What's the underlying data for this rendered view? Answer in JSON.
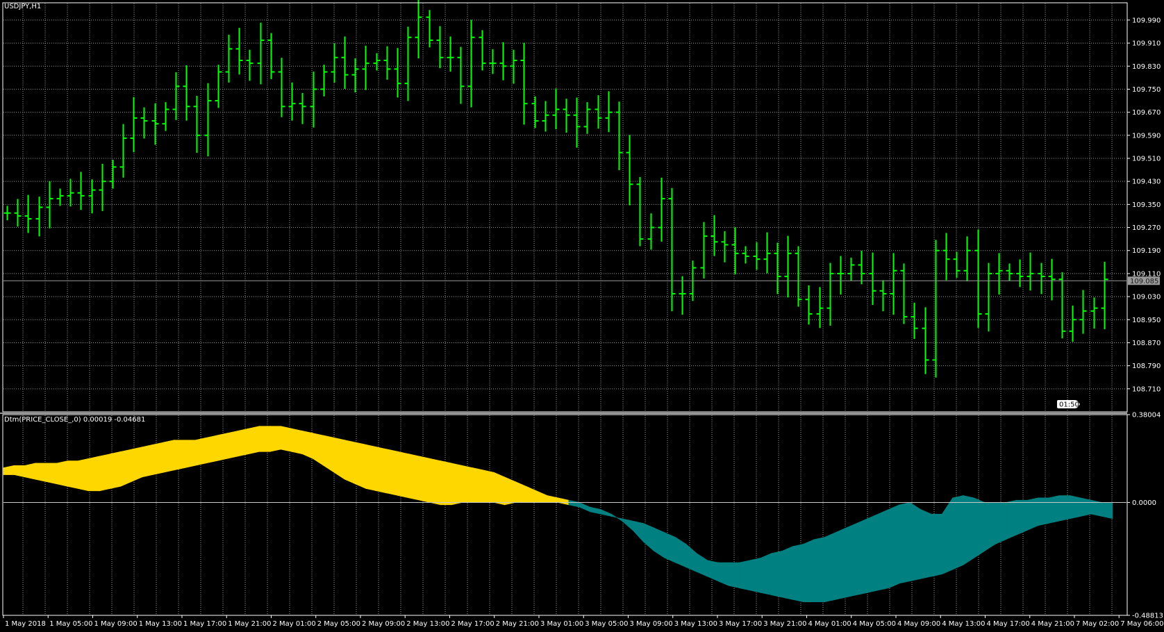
{
  "window": {
    "title": "USDJPY,H1",
    "indicator_title": "Dtm(PRICE_CLOSE_,0) 0.00019 -0.04681"
  },
  "colors": {
    "background": "#000000",
    "grid": "#9a9a9a",
    "bars": "#00ff00",
    "fill_positive": "#ffd700",
    "fill_negative": "#008080",
    "axis_text": "#ffffff"
  },
  "chart_data": [
    {
      "type": "ohlc",
      "symbol": "USDJPY",
      "timeframe": "H1",
      "title": "USDJPY,H1",
      "ylim": [
        108.63,
        110.05
      ],
      "y_ticks": [
        "109.990",
        "109.910",
        "109.830",
        "109.750",
        "109.670",
        "109.590",
        "109.510",
        "109.430",
        "109.350",
        "109.270",
        "109.190",
        "109.110",
        "109.030",
        "108.950",
        "108.870",
        "108.790",
        "108.710"
      ],
      "x_labels": [
        "1 May 2018",
        "1 May 05:00",
        "1 May 09:00",
        "1 May 13:00",
        "1 May 17:00",
        "1 May 21:00",
        "2 May 01:00",
        "2 May 05:00",
        "2 May 09:00",
        "2 May 13:00",
        "2 May 17:00",
        "2 May 21:00",
        "3 May 01:00",
        "3 May 05:00",
        "3 May 09:00",
        "3 May 13:00",
        "3 May 17:00",
        "3 May 21:00",
        "4 May 01:00",
        "4 May 05:00",
        "4 May 09:00",
        "4 May 13:00",
        "4 May 17:00",
        "4 May 21:00",
        "7 May 02:00",
        "7 May 06:00"
      ],
      "current_price": 109.085,
      "current_price_label": "109.085",
      "timer_label": "01:50",
      "close": [
        109.32,
        109.31,
        109.3,
        109.34,
        109.37,
        109.38,
        109.39,
        109.38,
        109.4,
        109.43,
        109.48,
        109.58,
        109.65,
        109.64,
        109.63,
        109.68,
        109.76,
        109.69,
        109.59,
        109.71,
        109.81,
        109.89,
        109.85,
        109.84,
        109.92,
        109.81,
        109.69,
        109.7,
        109.69,
        109.75,
        109.81,
        109.86,
        109.8,
        109.82,
        109.84,
        109.85,
        109.82,
        109.77,
        109.93,
        110.0,
        109.92,
        109.86,
        109.86,
        109.76,
        109.93,
        109.84,
        109.84,
        109.83,
        109.85,
        109.7,
        109.64,
        109.66,
        109.68,
        109.66,
        109.62,
        109.68,
        109.65,
        109.67,
        109.53,
        109.42,
        109.23,
        109.27,
        109.37,
        109.04,
        109.04,
        109.13,
        109.24,
        109.22,
        109.21,
        109.18,
        109.17,
        109.16,
        109.18,
        109.1,
        109.18,
        109.02,
        108.97,
        108.99,
        109.11,
        109.11,
        109.14,
        109.11,
        109.05,
        109.04,
        109.12,
        108.96,
        108.92,
        108.81,
        109.19,
        109.16,
        109.12,
        109.19,
        108.97,
        109.11,
        109.12,
        109.11,
        109.1,
        109.11,
        109.1,
        109.09,
        108.91,
        108.95,
        108.98,
        108.99,
        109.09
      ]
    },
    {
      "type": "area",
      "title": "Dtm(PRICE_CLOSE_,0) 0.00019 -0.04681",
      "ylim": [
        -0.48813,
        0.38004
      ],
      "y_ticks": [
        "0.38004",
        "0.0000",
        "-0.48813"
      ],
      "zero_line": 0.0,
      "series": [
        {
          "values": [
            0.15,
            0.16,
            0.16,
            0.17,
            0.17,
            0.17,
            0.18,
            0.18,
            0.19,
            0.2,
            0.21,
            0.22,
            0.23,
            0.24,
            0.25,
            0.26,
            0.27,
            0.27,
            0.27,
            0.28,
            0.29,
            0.3,
            0.31,
            0.32,
            0.33,
            0.33,
            0.33,
            0.32,
            0.31,
            0.3,
            0.29,
            0.28,
            0.27,
            0.26,
            0.25,
            0.24,
            0.23,
            0.22,
            0.21,
            0.2,
            0.19,
            0.18,
            0.17,
            0.16,
            0.15,
            0.14,
            0.13,
            0.11,
            0.09,
            0.07,
            0.05,
            0.03,
            0.02,
            0.01,
            0.0,
            -0.02,
            -0.03,
            -0.05,
            -0.08,
            -0.12,
            -0.17,
            -0.21,
            -0.24,
            -0.26,
            -0.28,
            -0.3,
            -0.32,
            -0.34,
            -0.36,
            -0.37,
            -0.38,
            -0.39,
            -0.4,
            -0.41,
            -0.42,
            -0.43,
            -0.43,
            -0.43,
            -0.42,
            -0.41,
            -0.4,
            -0.39,
            -0.38,
            -0.37,
            -0.35,
            -0.34,
            -0.33,
            -0.32,
            -0.31,
            -0.29,
            -0.27,
            -0.24,
            -0.21,
            -0.18,
            -0.16,
            -0.14,
            -0.12,
            -0.1,
            -0.09,
            -0.08,
            -0.07,
            -0.06,
            -0.05,
            -0.06,
            -0.07
          ]
        },
        {
          "values": [
            0.12,
            0.12,
            0.11,
            0.1,
            0.09,
            0.08,
            0.07,
            0.06,
            0.05,
            0.05,
            0.06,
            0.07,
            0.09,
            0.11,
            0.12,
            0.13,
            0.14,
            0.15,
            0.16,
            0.17,
            0.18,
            0.19,
            0.2,
            0.21,
            0.22,
            0.22,
            0.23,
            0.22,
            0.21,
            0.19,
            0.16,
            0.13,
            0.1,
            0.08,
            0.06,
            0.05,
            0.04,
            0.03,
            0.02,
            0.01,
            0.0,
            -0.01,
            -0.01,
            0.0,
            0.0,
            0.0,
            0.0,
            -0.01,
            0.0,
            0.0,
            0.0,
            0.0,
            0.0,
            -0.01,
            -0.02,
            -0.04,
            -0.05,
            -0.06,
            -0.07,
            -0.08,
            -0.09,
            -0.11,
            -0.13,
            -0.15,
            -0.18,
            -0.22,
            -0.25,
            -0.26,
            -0.26,
            -0.26,
            -0.25,
            -0.24,
            -0.22,
            -0.21,
            -0.19,
            -0.18,
            -0.16,
            -0.15,
            -0.13,
            -0.11,
            -0.09,
            -0.07,
            -0.05,
            -0.03,
            -0.01,
            0.0,
            -0.03,
            -0.05,
            -0.05,
            0.02,
            0.03,
            0.02,
            0.0,
            0.0,
            0.0,
            0.01,
            0.01,
            0.02,
            0.02,
            0.03,
            0.03,
            0.02,
            0.01,
            0.0,
            0.0
          ]
        }
      ]
    }
  ]
}
